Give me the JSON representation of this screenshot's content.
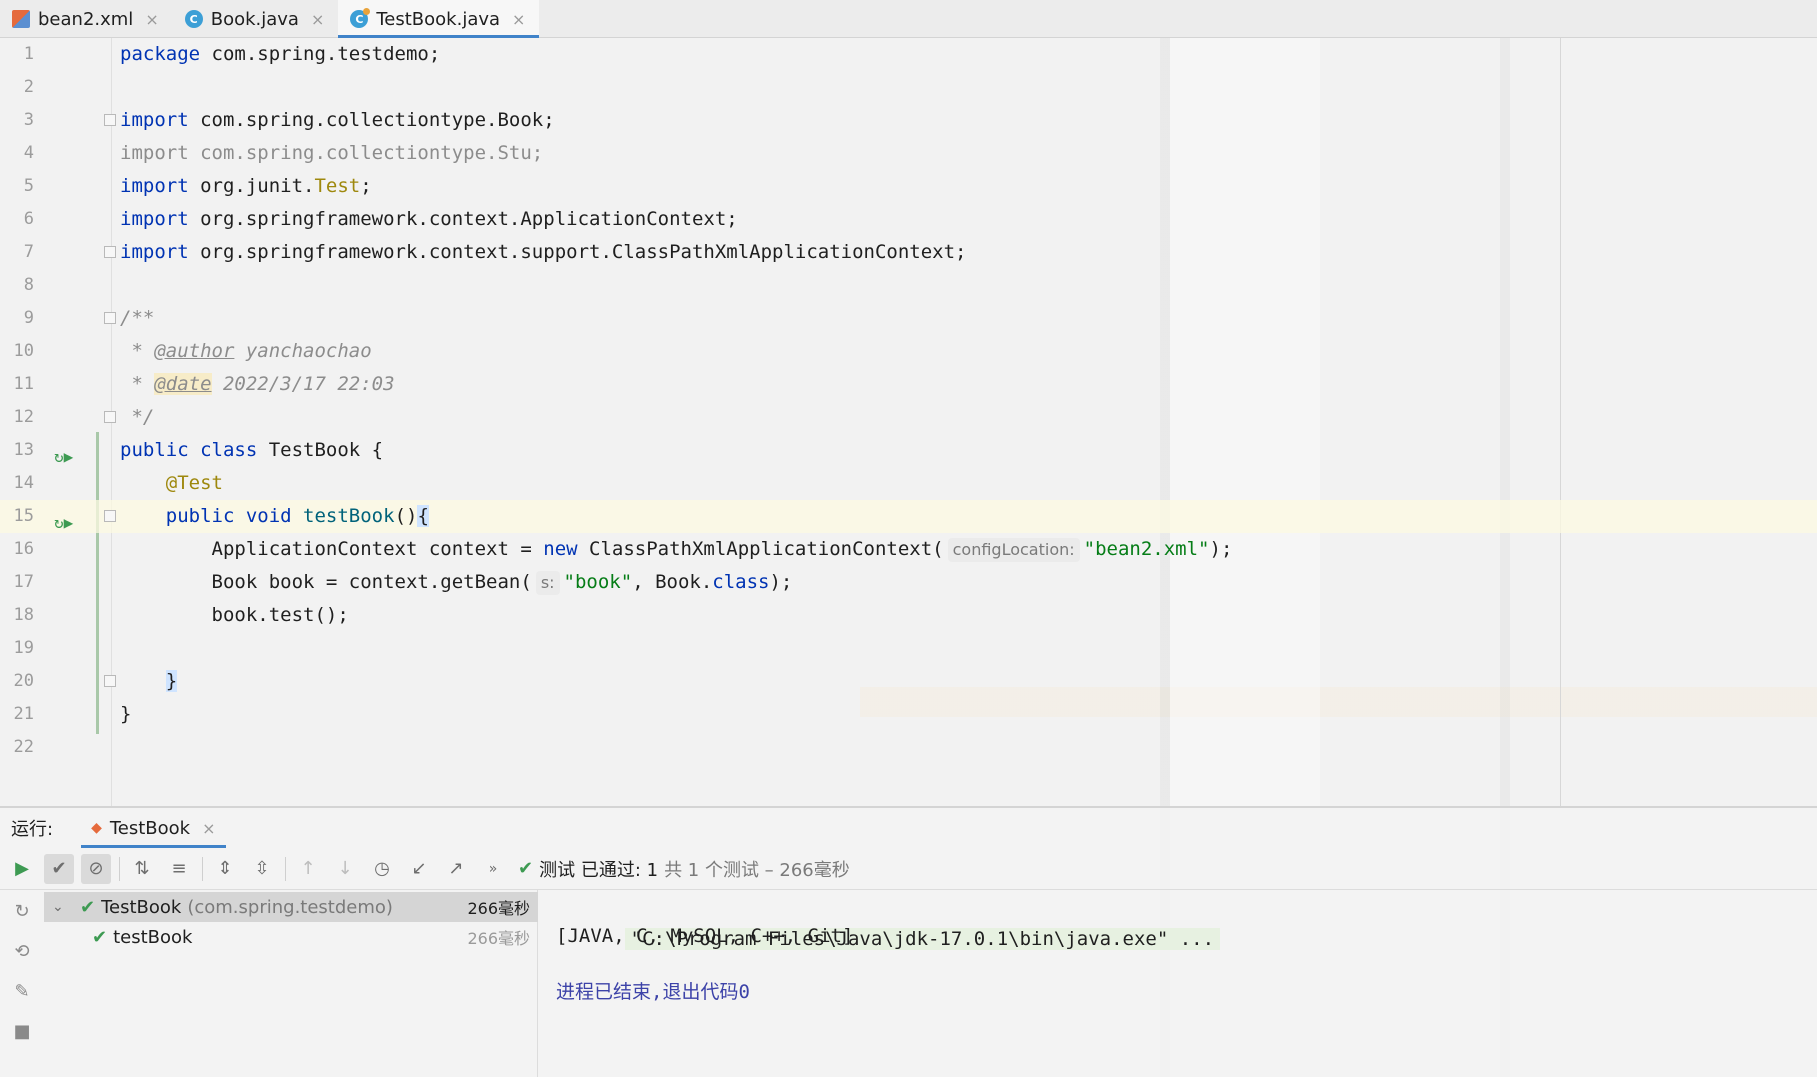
{
  "tabs": [
    {
      "label": "bean2.xml",
      "icon": "xml-file-icon",
      "active": false
    },
    {
      "label": "Book.java",
      "icon": "java-class-icon",
      "active": false
    },
    {
      "label": "TestBook.java",
      "icon": "java-test-class-icon",
      "active": true
    }
  ],
  "editor": {
    "line_numbers": [
      "1",
      "2",
      "3",
      "4",
      "5",
      "6",
      "7",
      "8",
      "9",
      "10",
      "11",
      "12",
      "13",
      "14",
      "15",
      "16",
      "17",
      "18",
      "19",
      "20",
      "21",
      "22"
    ],
    "lines": {
      "l1_kw": "package",
      "l1_rest": " com.spring.testdemo;",
      "l3_kw": "import",
      "l3_rest": " com.spring.collectiontype.Book;",
      "l4": "import com.spring.collectiontype.Stu;",
      "l5_kw": "import",
      "l5_a": " org.junit.",
      "l5_b": "Test",
      "l5_c": ";",
      "l6_kw": "import",
      "l6_rest": " org.springframework.context.ApplicationContext;",
      "l7_kw": "import",
      "l7_rest": " org.springframework.context.support.ClassPathXmlApplicationContext;",
      "l9": "/**",
      "l10_a": " * ",
      "l10_tag": "@author",
      "l10_b": " yanchaochao",
      "l11_a": " * ",
      "l11_tag": "@date",
      "l11_b": " 2022/3/17 22:03",
      "l12": " */",
      "l13_kw": "public class",
      "l13_rest": " TestBook {",
      "l14": "    @Test",
      "l15_indent": "    ",
      "l15_kw": "public void",
      "l15_name": " testBook",
      "l15_paren": "()",
      "l15_brace": "{",
      "l16_a": "        ApplicationContext context = ",
      "l16_kw": "new",
      "l16_b": " ClassPathXmlApplicationContext(",
      "l16_hint": "configLocation:",
      "l16_str": "\"bean2.xml\"",
      "l16_c": ");",
      "l17_a": "        Book book = context.getBean(",
      "l17_hint": "s:",
      "l17_str": "\"book\"",
      "l17_b": ", Book.",
      "l17_kw": "class",
      "l17_c": ");",
      "l18": "        book.test();",
      "l20_indent": "    ",
      "l20_brace": "}",
      "l21": "}"
    }
  },
  "run_panel": {
    "label": "运行:",
    "tab_label": "TestBook",
    "status_prefix": "测试 已通过: 1",
    "status_suffix": "共 1 个测试 – 266毫秒",
    "tree": [
      {
        "name": "TestBook",
        "package": "(com.spring.testdemo)",
        "time": "266毫秒"
      },
      {
        "name": "testBook",
        "time": "266毫秒"
      }
    ],
    "console": {
      "cmd": "\"C:\\Program Files\\Java\\jdk-17.0.1\\bin\\java.exe\" ...",
      "output": "[JAVA, C, MySQL, C++, Git]",
      "exit": "进程已结束,退出代码0"
    }
  }
}
